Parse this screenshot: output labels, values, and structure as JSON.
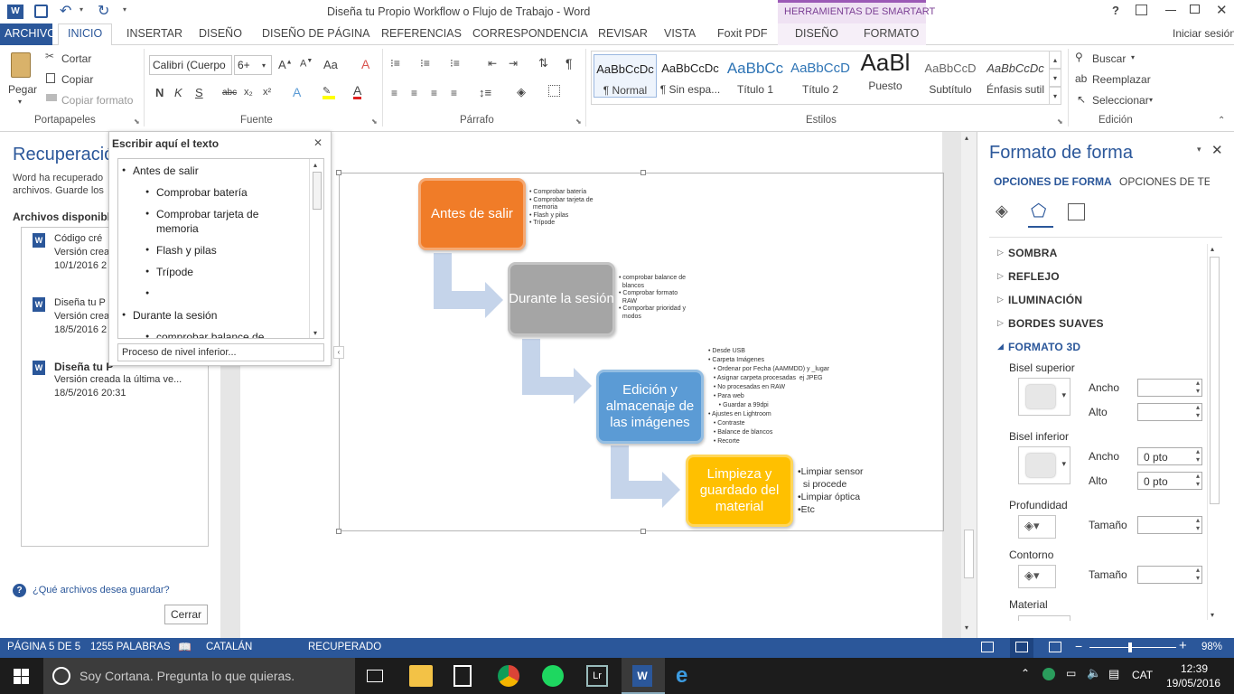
{
  "window": {
    "title": "Diseña tu Propio Workflow o Flujo de Trabajo - Word",
    "contextual_group": "HERRAMIENTAS DE SMARTART",
    "help": "?",
    "signin": "Iniciar sesión"
  },
  "tabs": [
    "ARCHIVO",
    "INICIO",
    "INSERTAR",
    "DISEÑO",
    "DISEÑO DE PÁGINA",
    "REFERENCIAS",
    "CORRESPONDENCIA",
    "REVISAR",
    "VISTA",
    "Foxit PDF",
    "DISEÑO",
    "FORMATO"
  ],
  "clipboard": {
    "paste": "Pegar",
    "cut": "Cortar",
    "copy": "Copiar",
    "format_painter": "Copiar formato",
    "group": "Portapapeles"
  },
  "font": {
    "name": "Calibri (Cuerpo",
    "size": "6+",
    "bold": "N",
    "italic": "K",
    "underline": "S",
    "strike": "abc",
    "sub": "x₂",
    "sup": "x²",
    "case": "Aa",
    "group": "Fuente"
  },
  "paragraph": {
    "group": "Párrafo",
    "pilcrow": "¶"
  },
  "styles": {
    "items": [
      {
        "preview": "AaBbCcDc",
        "name": "¶ Normal"
      },
      {
        "preview": "AaBbCcDc",
        "name": "¶ Sin espa..."
      },
      {
        "preview": "AaBbCc",
        "name": "Título 1"
      },
      {
        "preview": "AaBbCcD",
        "name": "Título 2"
      },
      {
        "preview": "AaBl",
        "name": "Puesto"
      },
      {
        "preview": "AaBbCcD",
        "name": "Subtítulo"
      },
      {
        "preview": "AaBbCcDc",
        "name": "Énfasis sutil"
      }
    ],
    "group": "Estilos"
  },
  "editing": {
    "find": "Buscar",
    "replace": "Reemplazar",
    "select": "Seleccionar",
    "group": "Edición"
  },
  "recovery": {
    "title": "Recuperación",
    "desc": "Word ha recuperado archivos. Guarde los",
    "available": "Archivos disponibles",
    "files": [
      {
        "name": "Código cré",
        "version": "Versión crea",
        "date": "10/1/2016 2"
      },
      {
        "name": "Diseña tu P",
        "version": "Versión crea",
        "date": "18/5/2016 2"
      },
      {
        "name": "Diseña tu P",
        "version": "Versión creada la última ve...",
        "date": "18/5/2016 20:31"
      }
    ],
    "question": "¿Qué archivos desea guardar?",
    "close": "Cerrar"
  },
  "text_pane": {
    "title": "Escribir aquí el texto",
    "close": "✕",
    "lines": [
      {
        "level": 1,
        "text": "Antes de salir"
      },
      {
        "level": 2,
        "text": "Comprobar batería"
      },
      {
        "level": 2,
        "text": "Comprobar tarjeta de memoria"
      },
      {
        "level": 2,
        "text": "Flash y pilas"
      },
      {
        "level": 2,
        "text": "Trípode"
      },
      {
        "level": 2,
        "text": ""
      },
      {
        "level": 1,
        "text": "Durante la sesión"
      },
      {
        "level": 2,
        "text": "comprobar balance de"
      }
    ],
    "footer": "Proceso de nivel inferior..."
  },
  "smartart": {
    "steps": [
      {
        "title": "Antes de salir",
        "color": "#f07c28",
        "bullets": [
          "• Comprobar batería",
          "• Comprobar tarjeta de",
          "  memoria",
          "• Flash y pilas",
          "• Trípode"
        ]
      },
      {
        "title": "Durante la sesión",
        "color": "#a5a5a5",
        "bullets": [
          "• comprobar balance de",
          "  blancos",
          "• Comprobar formato",
          "  RAW",
          "• Comporbar prioridad y",
          "  modos"
        ]
      },
      {
        "title": "Edición y almacenaje de las imágenes",
        "color": "#5b9bd5",
        "bullets": [
          "• Desde USB",
          "• Carpeta Imágenes",
          "   • Ordenar por Fecha (AAMMDD) y _lugar",
          "   • Asignar carpeta procesadas  ej JPEG",
          "   • No procesadas en RAW",
          "   • Para web",
          "      • Guardar a 99dpi",
          "• Ajustes en Lightroom",
          "   • Contraste",
          "   • Balance de blancos",
          "   • Recorte"
        ]
      },
      {
        "title": "Limpieza y guardado del material",
        "color": "#ffc000",
        "bullets": [
          "•Limpiar sensor",
          "  si procede",
          "•Limpiar óptica",
          "•Etc"
        ]
      }
    ]
  },
  "format_pane": {
    "title": "Formato de forma",
    "tab1": "OPCIONES DE FORMA",
    "tab2": "OPCIONES DE TEXTO",
    "sections": [
      "SOMBRA",
      "REFLEJO",
      "ILUMINACIÓN",
      "BORDES SUAVES",
      "FORMATO 3D"
    ],
    "bevel_top": "Bisel superior",
    "bevel_bottom": "Bisel inferior",
    "width": "Ancho",
    "height": "Alto",
    "depth": "Profundidad",
    "contour": "Contorno",
    "size": "Tamaño",
    "material": "Material",
    "bottom_width_val": "0 pto",
    "bottom_height_val": "0 pto"
  },
  "status": {
    "page": "PÁGINA 5 DE 5",
    "words": "1255 PALABRAS",
    "lang": "CATALÁN",
    "state": "RECUPERADO",
    "zoom": "98%"
  },
  "taskbar": {
    "cortana": "Soy Cortana. Pregunta lo que quieras.",
    "lang": "CAT",
    "time": "12:39",
    "date": "19/05/2016"
  },
  "colors": {
    "accent": "#2b579a",
    "contextual": "#8e44ad"
  }
}
